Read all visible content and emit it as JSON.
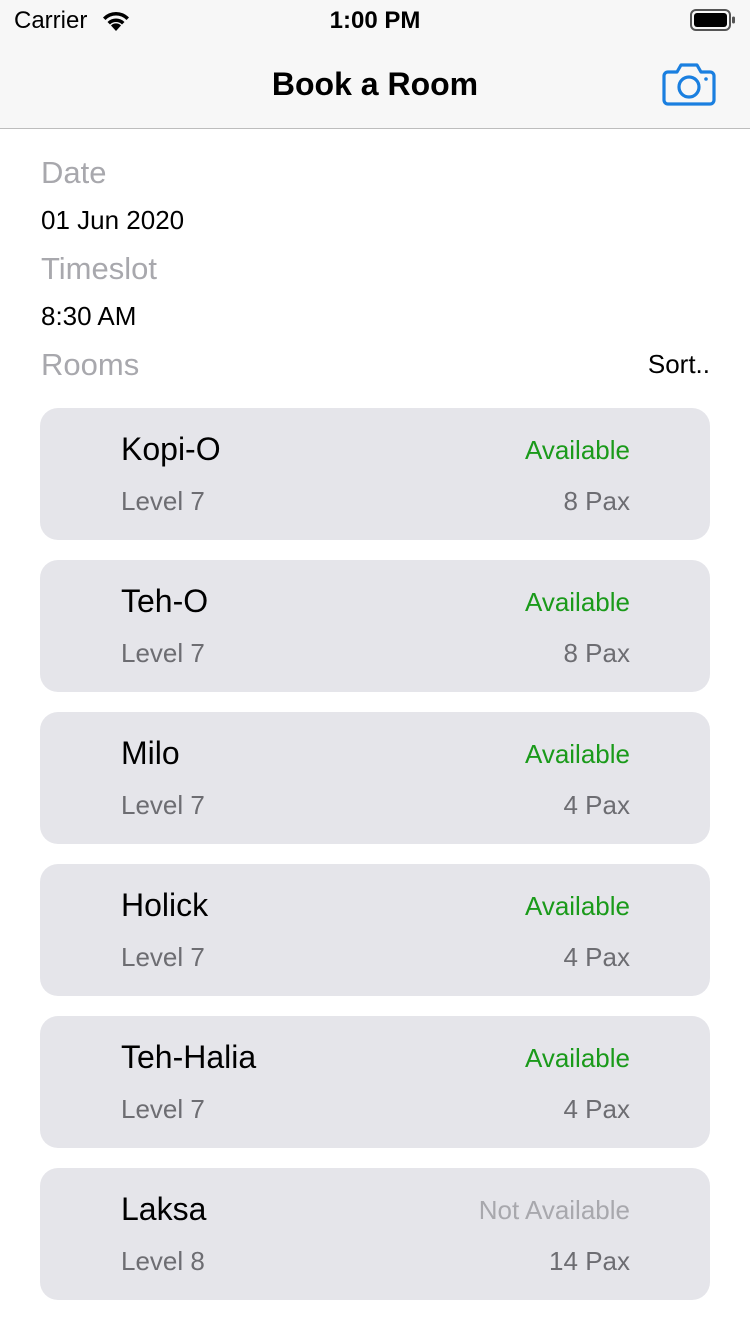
{
  "status_bar": {
    "carrier": "Carrier",
    "time": "1:00 PM",
    "wifi_icon": "wifi-icon",
    "battery_icon": "battery-icon"
  },
  "nav": {
    "title": "Book a Room",
    "camera_icon": "camera-icon",
    "accent_color": "#1a7fe0"
  },
  "form": {
    "date_label": "Date",
    "date_value": "01 Jun 2020",
    "timeslot_label": "Timeslot",
    "timeslot_value": "8:30 AM",
    "rooms_label": "Rooms",
    "sort_label": "Sort.."
  },
  "colors": {
    "available": "#1a9a1a",
    "not_available": "#a8a8ad"
  },
  "rooms": [
    {
      "name": "Kopi-O",
      "level": "Level 7",
      "status": "Available",
      "available": true,
      "pax": "8 Pax"
    },
    {
      "name": "Teh-O",
      "level": "Level 7",
      "status": "Available",
      "available": true,
      "pax": "8 Pax"
    },
    {
      "name": "Milo",
      "level": "Level 7",
      "status": "Available",
      "available": true,
      "pax": "4 Pax"
    },
    {
      "name": "Holick",
      "level": "Level 7",
      "status": "Available",
      "available": true,
      "pax": "4 Pax"
    },
    {
      "name": "Teh-Halia",
      "level": "Level 7",
      "status": "Available",
      "available": true,
      "pax": "4 Pax"
    },
    {
      "name": "Laksa",
      "level": "Level 8",
      "status": "Not Available",
      "available": false,
      "pax": "14 Pax"
    }
  ]
}
